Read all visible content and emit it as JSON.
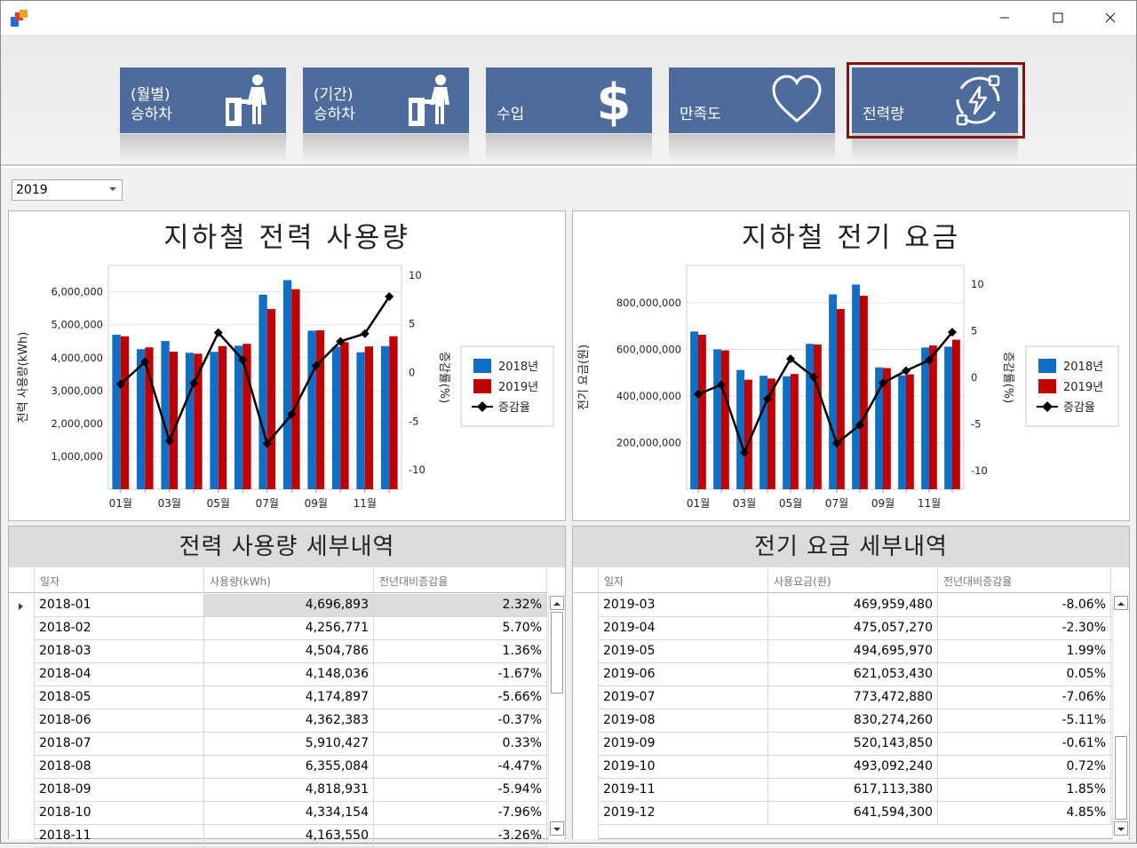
{
  "window": {
    "minimize": "—",
    "maximize": "☐",
    "close": "✕"
  },
  "tiles": [
    {
      "label": "(월별)\n승하차",
      "icon": "turnstile-person-icon"
    },
    {
      "label": "(기간)\n승하차",
      "icon": "turnstile-person-icon"
    },
    {
      "label": "수입",
      "icon": "dollar-icon"
    },
    {
      "label": "만족도",
      "icon": "heart-icon"
    },
    {
      "label": "전력량",
      "icon": "power-plug-icon"
    }
  ],
  "year_select": {
    "value": "2019"
  },
  "charts": {
    "power": {
      "title": "지하철 전력 사용량",
      "ylabel": "전력 사용량(kWh)",
      "y2label": "증감률(%)"
    },
    "fee": {
      "title": "지하철 전기 요금",
      "ylabel": "전기 요금(원)",
      "y2label": "증감률(%)"
    }
  },
  "chart_data": [
    {
      "type": "bar",
      "title": "지하철 전력 사용량",
      "categories": [
        "01월",
        "02월",
        "03월",
        "04월",
        "05월",
        "06월",
        "07월",
        "08월",
        "09월",
        "10월",
        "11월",
        "12월"
      ],
      "x_tick_labels": [
        "01월",
        "03월",
        "05월",
        "07월",
        "09월",
        "11월"
      ],
      "ylabel": "전력 사용량(kWh)",
      "y2label": "증감률(%)",
      "ylim": [
        0,
        6800000
      ],
      "y_ticks": [
        "1,000,000",
        "2,000,000",
        "3,000,000",
        "4,000,000",
        "5,000,000",
        "6,000,000"
      ],
      "y2lim": [
        -12,
        11
      ],
      "y2_ticks": [
        "-10",
        "-5",
        "0",
        "5",
        "10"
      ],
      "series": [
        {
          "name": "2018년",
          "kind": "bar",
          "color": "#0f6fc6",
          "values": [
            4696893,
            4256771,
            4504786,
            4148036,
            4174897,
            4362383,
            5910427,
            6355084,
            4818931,
            4334154,
            4163550,
            4350000
          ]
        },
        {
          "name": "2019년",
          "kind": "bar",
          "color": "#c00000",
          "values": [
            4650000,
            4310000,
            4180000,
            4120000,
            4350000,
            4420000,
            5480000,
            6080000,
            4830000,
            4470000,
            4340000,
            4650000
          ]
        },
        {
          "name": "증감율",
          "kind": "line",
          "axis": "y2",
          "color": "#000000",
          "values": [
            -1.2,
            1.1,
            -7.0,
            -1.1,
            4.1,
            1.3,
            -7.3,
            -4.3,
            0.7,
            3.2,
            4.0,
            7.8
          ]
        }
      ],
      "legend": "right",
      "grid": true
    },
    {
      "type": "bar",
      "title": "지하철 전기 요금",
      "categories": [
        "01월",
        "02월",
        "03월",
        "04월",
        "05월",
        "06월",
        "07월",
        "08월",
        "09월",
        "10월",
        "11월",
        "12월"
      ],
      "x_tick_labels": [
        "01월",
        "03월",
        "05월",
        "07월",
        "09월",
        "11월"
      ],
      "ylabel": "전기 요금(원)",
      "y2label": "증감률(%)",
      "ylim": [
        0,
        960000000
      ],
      "y_ticks": [
        "200,000,000",
        "400,000,000",
        "600,000,000",
        "800,000,000"
      ],
      "y2_ticks": [
        "-10",
        "-5",
        "0",
        "5",
        "10"
      ],
      "y2lim": [
        -12,
        12
      ],
      "series": [
        {
          "name": "2018년",
          "kind": "bar",
          "color": "#0f6fc6",
          "values": [
            677000000,
            600000000,
            512000000,
            487000000,
            485000000,
            624000000,
            836000000,
            878000000,
            523000000,
            489000000,
            608000000,
            612000000
          ]
        },
        {
          "name": "2019년",
          "kind": "bar",
          "color": "#c00000",
          "values": [
            663000000,
            596000000,
            469959480,
            475057270,
            494695970,
            621053430,
            773472880,
            830274260,
            520143850,
            493092240,
            617113380,
            641594300
          ]
        },
        {
          "name": "증감율",
          "kind": "line",
          "axis": "y2",
          "color": "#000000",
          "values": [
            -1.8,
            -0.8,
            -8.06,
            -2.3,
            1.99,
            0.05,
            -7.06,
            -5.11,
            -0.61,
            0.72,
            1.85,
            4.85
          ]
        }
      ],
      "legend": "right",
      "grid": true
    }
  ],
  "power_grid": {
    "title": "전력 사용량 세부내역",
    "columns": [
      "일자",
      "사용량(kWh)",
      "전년대비증감율"
    ],
    "rows": [
      [
        "2018-01",
        "4,696,893",
        "2.32%"
      ],
      [
        "2018-02",
        "4,256,771",
        "5.70%"
      ],
      [
        "2018-03",
        "4,504,786",
        "1.36%"
      ],
      [
        "2018-04",
        "4,148,036",
        "-1.67%"
      ],
      [
        "2018-05",
        "4,174,897",
        "-5.66%"
      ],
      [
        "2018-06",
        "4,362,383",
        "-0.37%"
      ],
      [
        "2018-07",
        "5,910,427",
        "0.33%"
      ],
      [
        "2018-08",
        "6,355,084",
        "-4.47%"
      ],
      [
        "2018-09",
        "4,818,931",
        "-5.94%"
      ],
      [
        "2018-10",
        "4,334,154",
        "-7.96%"
      ],
      [
        "2018-11",
        "4,163,550",
        "-3.26%"
      ]
    ]
  },
  "fee_grid": {
    "title": "전기 요금 세부내역",
    "columns": [
      "일자",
      "사용요금(원)",
      "전년대비증감율"
    ],
    "rows": [
      [
        "2019-03",
        "469,959,480",
        "-8.06%"
      ],
      [
        "2019-04",
        "475,057,270",
        "-2.30%"
      ],
      [
        "2019-05",
        "494,695,970",
        "1.99%"
      ],
      [
        "2019-06",
        "621,053,430",
        "0.05%"
      ],
      [
        "2019-07",
        "773,472,880",
        "-7.06%"
      ],
      [
        "2019-08",
        "830,274,260",
        "-5.11%"
      ],
      [
        "2019-09",
        "520,143,850",
        "-0.61%"
      ],
      [
        "2019-10",
        "493,092,240",
        "0.72%"
      ],
      [
        "2019-11",
        "617,113,380",
        "1.85%"
      ],
      [
        "2019-12",
        "641,594,300",
        "4.85%"
      ]
    ]
  }
}
